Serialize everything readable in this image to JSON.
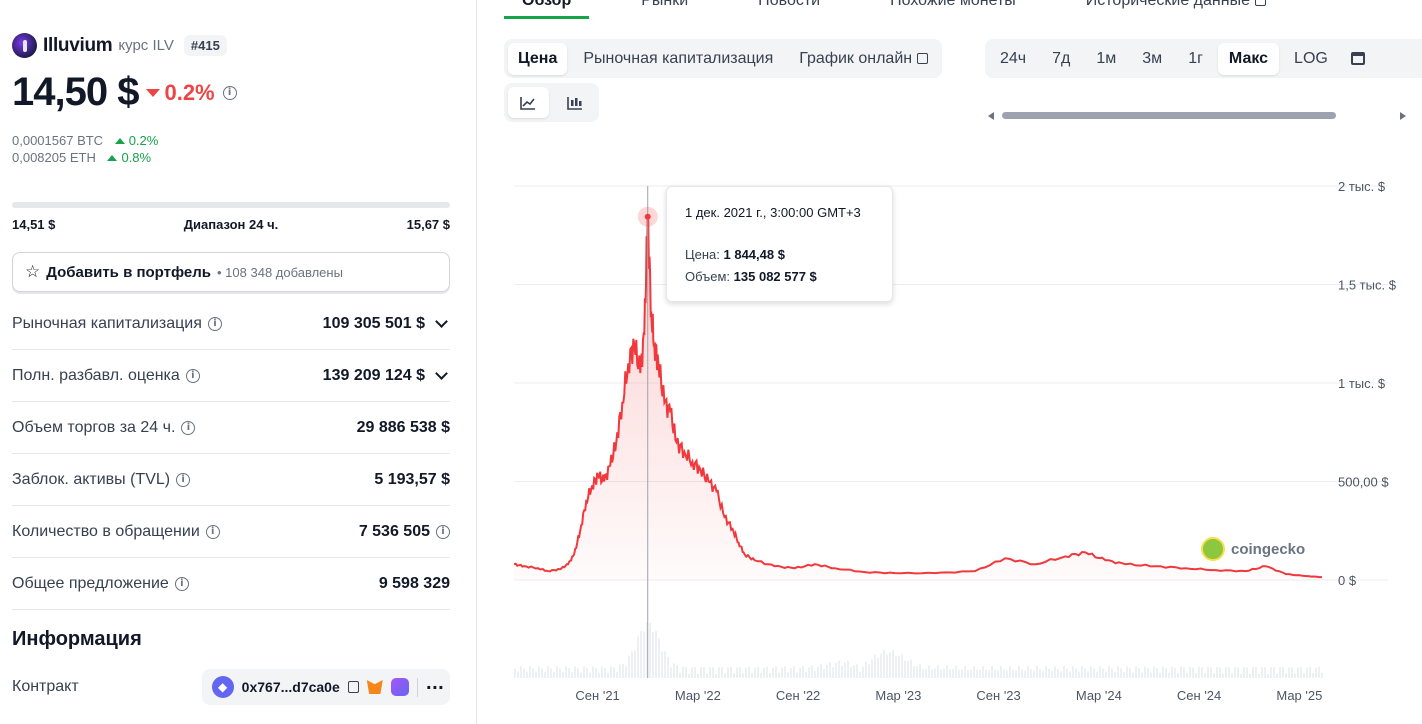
{
  "coin": {
    "name": "Illuvium",
    "subtitle": "курс ILV",
    "rank": "#415",
    "price": "14,50 $",
    "change_24h": "0.2%",
    "btc_price": "0,0001567 BTC",
    "btc_change": "0.2%",
    "eth_price": "0,008205 ETH",
    "eth_change": "0.8%",
    "range_low": "14,51 $",
    "range_label": "Диапазон 24 ч.",
    "range_high": "15,67 $"
  },
  "portfolio": {
    "label": "Добавить в портфель",
    "added": "• 108 348 добавлены"
  },
  "stats": [
    {
      "label": "Рыночная капитализация",
      "value": "109 305 501 $"
    },
    {
      "label": "Полн. разбавл. оценка",
      "value": "139 209 124 $"
    },
    {
      "label": "Объем торгов за 24 ч.",
      "value": "29 886 538 $"
    },
    {
      "label": "Заблок. активы (TVL)",
      "value": "5 193,57 $"
    },
    {
      "label": "Количество в обращении",
      "value": "7 536 505"
    },
    {
      "label": "Общее предложение",
      "value": "9 598 329"
    }
  ],
  "info": {
    "title": "Информация",
    "contract_label": "Контракт",
    "contract_address": "0x767...d7ca0e"
  },
  "tabs": [
    "Обзор",
    "Рынки",
    "Новости",
    "Похожие монеты",
    "Исторические данные"
  ],
  "chart_types": [
    "Цена",
    "Рыночная капитализация",
    "График онлайн"
  ],
  "ranges": [
    "24ч",
    "7д",
    "1м",
    "3м",
    "1г",
    "Макс",
    "LOG"
  ],
  "colors": {
    "accent_green": "#16a34a",
    "down_red": "#ef4444",
    "line": "#f0393c"
  },
  "tooltip": {
    "date": "1 дек. 2021 г., 3:00:00 GMT+3",
    "price_label": "Цена:",
    "price_value": "1 844,48 $",
    "volume_label": "Объем:",
    "volume_value": "135 082 577 $"
  },
  "watermark": "coingecko",
  "chart_data": {
    "type": "line",
    "y_tick_labels": [
      "0 $",
      "500,00 $",
      "1 тыс. $",
      "1,5 тыс. $",
      "2 тыс. $"
    ],
    "y_ticks": [
      0,
      500,
      1000,
      1500,
      2000
    ],
    "ylim": [
      0,
      2000
    ],
    "x_tick_labels": [
      "Сен '21",
      "Мар '22",
      "Сен '22",
      "Мар '23",
      "Сен '23",
      "Мар '24",
      "Сен '24",
      "Мар '25"
    ],
    "x_ticks": [
      2021.667,
      2022.167,
      2022.667,
      2023.167,
      2023.667,
      2024.167,
      2024.667,
      2025.167
    ],
    "xlim": [
      2021.25,
      2025.28
    ],
    "series": [
      {
        "x": [
          2021.25,
          2021.3,
          2021.37,
          2021.42,
          2021.48,
          2021.52,
          2021.55,
          2021.58,
          2021.61,
          2021.64,
          2021.67,
          2021.7,
          2021.73,
          2021.76,
          2021.79,
          2021.82,
          2021.85,
          2021.88,
          2021.9,
          2021.917,
          2021.935,
          2021.95,
          2021.97,
          2022.0,
          2022.03,
          2022.06,
          2022.1,
          2022.14,
          2022.18,
          2022.22,
          2022.26,
          2022.3,
          2022.34,
          2022.37,
          2022.4,
          2022.45,
          2022.55,
          2022.65,
          2022.75,
          2022.85,
          2023.0,
          2023.15,
          2023.35,
          2023.55,
          2023.7,
          2023.85,
          2024.0,
          2024.1,
          2024.2,
          2024.3,
          2024.45,
          2024.6,
          2024.75,
          2024.9,
          2025.0,
          2025.1,
          2025.2,
          2025.28
        ],
        "y": [
          80,
          70,
          60,
          45,
          55,
          80,
          130,
          250,
          400,
          480,
          530,
          500,
          580,
          700,
          900,
          1100,
          1200,
          1050,
          1250,
          1844,
          1350,
          1200,
          1100,
          900,
          850,
          700,
          650,
          600,
          560,
          500,
          450,
          320,
          260,
          190,
          130,
          100,
          70,
          60,
          80,
          60,
          40,
          35,
          35,
          45,
          110,
          80,
          120,
          140,
          100,
          80,
          70,
          60,
          50,
          45,
          70,
          30,
          20,
          14.5
        ]
      }
    ]
  }
}
